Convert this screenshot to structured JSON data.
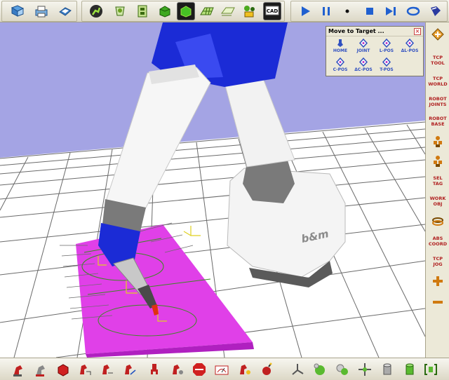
{
  "top_toolbar": {
    "buttons": [
      {
        "name": "open-file-icon"
      },
      {
        "name": "print-icon"
      },
      {
        "name": "save-icon"
      },
      {
        "name": "robot-arm-icon"
      },
      {
        "name": "tool-icon"
      },
      {
        "name": "film-icon"
      },
      {
        "name": "green-box-icon"
      },
      {
        "name": "green-box-selected-icon"
      },
      {
        "name": "grid-icon"
      },
      {
        "name": "grid-layer-icon"
      },
      {
        "name": "robot-group-icon"
      },
      {
        "name": "cad-button",
        "label": "CAD"
      },
      {
        "name": "play-icon"
      },
      {
        "name": "pause-icon"
      },
      {
        "name": "step-dot-icon"
      },
      {
        "name": "stop-icon"
      },
      {
        "name": "skip-forward-icon"
      },
      {
        "name": "loop-icon"
      },
      {
        "name": "record-icon"
      }
    ]
  },
  "move_to_target": {
    "title": "Move to Target ...",
    "close_label": "×",
    "buttons": [
      {
        "label": "HOME"
      },
      {
        "label": "JOINT"
      },
      {
        "label": "L-POS"
      },
      {
        "label": "ΔL-POS"
      },
      {
        "label": "C-POS"
      },
      {
        "label": "ΔC-POS"
      },
      {
        "label": "T-POS"
      }
    ]
  },
  "right_bar": {
    "items": [
      {
        "type": "icon",
        "name": "target-diamond-icon"
      },
      {
        "type": "label",
        "text": "TCP\nTOOL"
      },
      {
        "type": "label",
        "text": "TCP\nWORLD"
      },
      {
        "type": "label",
        "text": "ROBOT\nJOINTS"
      },
      {
        "type": "label",
        "text": "ROBOT\nBASE"
      },
      {
        "type": "icon",
        "name": "stack-icon"
      },
      {
        "type": "icon",
        "name": "stack-alt-icon"
      },
      {
        "type": "label",
        "text": "SEL\nTAG"
      },
      {
        "type": "label",
        "text": "WORK\nOBJ"
      },
      {
        "type": "icon",
        "name": "coil-icon"
      },
      {
        "type": "label",
        "text": "ABS\nCOORD"
      },
      {
        "type": "label",
        "text": "TCP\nJOG"
      },
      {
        "type": "icon",
        "name": "plus-icon"
      },
      {
        "type": "icon",
        "name": "minus-icon"
      }
    ]
  },
  "scene": {
    "base_label": "b&m",
    "colors": {
      "sky": "#a4a4e4",
      "floor": "#ffffff",
      "grid": "#6a6a6a",
      "robot_blue": "#1b2bd6",
      "robot_white": "#f4f4f4",
      "robot_gray": "#7a7a7a",
      "workpiece": "#e040e8"
    }
  },
  "bottom_toolbar": {
    "buttons": [
      {
        "name": "robot-red-icon"
      },
      {
        "name": "robot-gray-icon"
      },
      {
        "name": "red-cube-icon"
      },
      {
        "name": "robot-move-icon"
      },
      {
        "name": "robot-jog-icon"
      },
      {
        "name": "robot-path-icon"
      },
      {
        "name": "gripper-icon"
      },
      {
        "name": "robot-tool-icon"
      },
      {
        "name": "stop-sign-icon"
      },
      {
        "name": "gauge-icon"
      },
      {
        "name": "robot-settings-icon"
      },
      {
        "name": "bomb-icon"
      },
      {
        "name": "axes-icon"
      },
      {
        "name": "green-sphere-icon"
      },
      {
        "name": "two-spheres-icon"
      },
      {
        "name": "move-arrows-icon"
      },
      {
        "name": "cylinder-icon"
      },
      {
        "name": "green-cylinder-icon"
      },
      {
        "name": "bracket-icon"
      }
    ]
  }
}
